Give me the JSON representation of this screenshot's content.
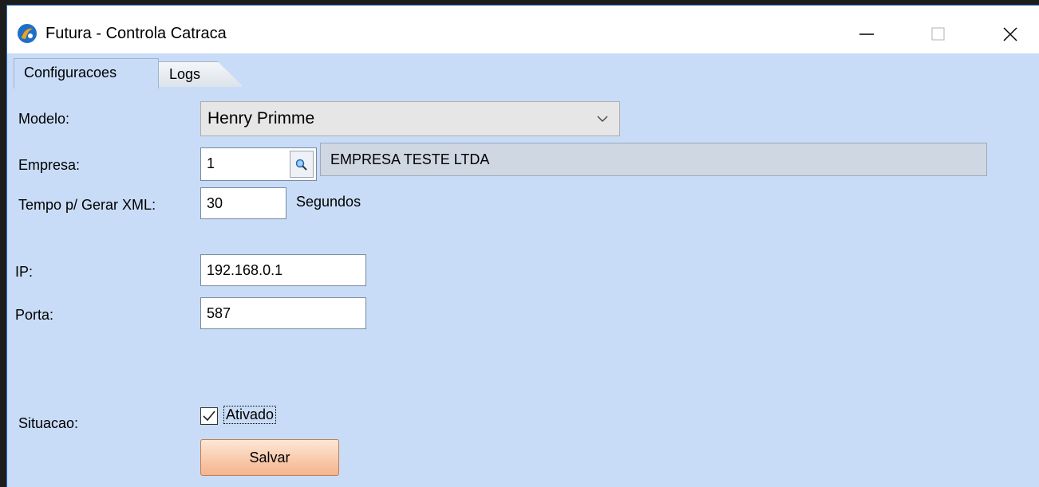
{
  "window": {
    "title": "Futura - Controla Catraca",
    "controls": [
      "minimize",
      "maximize",
      "close"
    ]
  },
  "tabs": [
    {
      "label": "Configuracoes",
      "active": true
    },
    {
      "label": "Logs",
      "active": false
    }
  ],
  "form": {
    "modelo": {
      "label": "Modelo:",
      "value": "Henry Primme"
    },
    "empresa": {
      "label": "Empresa:",
      "code": "1",
      "name": "EMPRESA TESTE LTDA"
    },
    "tempo": {
      "label": "Tempo p/ Gerar XML:",
      "value": "30",
      "unit": "Segundos"
    },
    "ip": {
      "label": "IP:",
      "value": "192.168.0.1"
    },
    "porta": {
      "label": "Porta:",
      "value": "587"
    },
    "situacao": {
      "label": "Situacao:",
      "checkbox_label": "Ativado",
      "checked": true
    },
    "save_label": "Salvar"
  },
  "icons": {
    "app": "futura-logo-icon",
    "lookup": "magnifier-icon",
    "dropdown": "chevron-down-icon",
    "check": "checkmark-icon"
  },
  "colors": {
    "window_bg": "#c8dcf7",
    "accent_border": "#2b73c9",
    "save_button": "#f5b48c"
  }
}
